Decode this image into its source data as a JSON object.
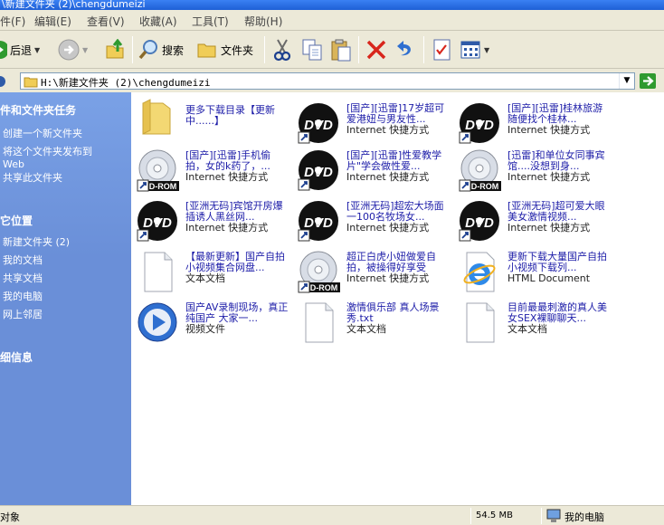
{
  "window": {
    "title": "\\新建文件夹 (2)\\chengdumeizi"
  },
  "menu": [
    {
      "label": "件(F)"
    },
    {
      "label": "编辑(E)"
    },
    {
      "label": "查看(V)"
    },
    {
      "label": "收藏(A)"
    },
    {
      "label": "工具(T)"
    },
    {
      "label": "帮助(H)"
    }
  ],
  "toolbar": {
    "back_label": "后退",
    "search_label": "搜索",
    "folders_label": "文件夹"
  },
  "address": {
    "path": "H:\\新建文件夹 (2)\\chengdumeizi"
  },
  "left_pane": {
    "tasks_title": "件和文件夹任务",
    "tasks": [
      "创建一个新文件夹",
      "将这个文件夹发布到",
      "Web",
      "共享此文件夹"
    ],
    "places_title": "它位置",
    "places": [
      "新建文件夹 (2)",
      "我的文档",
      "共享文档",
      "我的电脑",
      "网上邻居"
    ],
    "details_title": "细信息"
  },
  "files": [
    {
      "icon": "folder",
      "name": "更多下载目录【更新中......】",
      "type": ""
    },
    {
      "icon": "dvd",
      "name": "[国产][迅雷]17岁超可爱港妞与男友性...",
      "type": "Internet 快捷方式"
    },
    {
      "icon": "dvd",
      "name": "[国产][迅雷]桂林旅游随便找个桂林...",
      "type": "Internet 快捷方式"
    },
    {
      "icon": "cdrom",
      "name": "[国产][迅雷]手机偷拍，女的k药了，...",
      "type": "Internet 快捷方式"
    },
    {
      "icon": "dvd",
      "name": "[国产][迅雷]性爱教学片\"学会做性爱...",
      "type": "Internet 快捷方式"
    },
    {
      "icon": "cdrom",
      "name": "[迅雷]和单位女同事宾馆....没想到身...",
      "type": "Internet 快捷方式"
    },
    {
      "icon": "dvd",
      "name": "[亚洲无码]宾馆开房爆插诱人黑丝网...",
      "type": "Internet 快捷方式"
    },
    {
      "icon": "dvd",
      "name": "[亚洲无码]超宏大场面一100名牧场女...",
      "type": "Internet 快捷方式"
    },
    {
      "icon": "dvd",
      "name": "[亚洲无码]超可爱大眼美女激情视频...",
      "type": "Internet 快捷方式"
    },
    {
      "icon": "text",
      "name": "【最新更新】国产自拍小视频集合网盘...",
      "type": "文本文档"
    },
    {
      "icon": "cdrom",
      "name": "超正白虎小妞做爱自拍，被操得好享受",
      "type": "Internet 快捷方式"
    },
    {
      "icon": "ie",
      "name": "更新下载大量国产自拍小视频下载列...",
      "type": "HTML Document"
    },
    {
      "icon": "media",
      "name": "国产AV录制现场，真正纯国产 大家一...",
      "type": "视频文件"
    },
    {
      "icon": "text",
      "name": "激情俱乐部 真人场景秀.txt",
      "type": "文本文档"
    },
    {
      "icon": "text",
      "name": "目前最最刺激的真人美女SEX裸聊聊天...",
      "type": "文本文档"
    }
  ],
  "status": {
    "objects": "对象",
    "size": "54.5 MB",
    "location": "我的电脑"
  },
  "colors": {
    "left_pane": "#6a8fd8",
    "link_text": "#1c1ca8"
  }
}
